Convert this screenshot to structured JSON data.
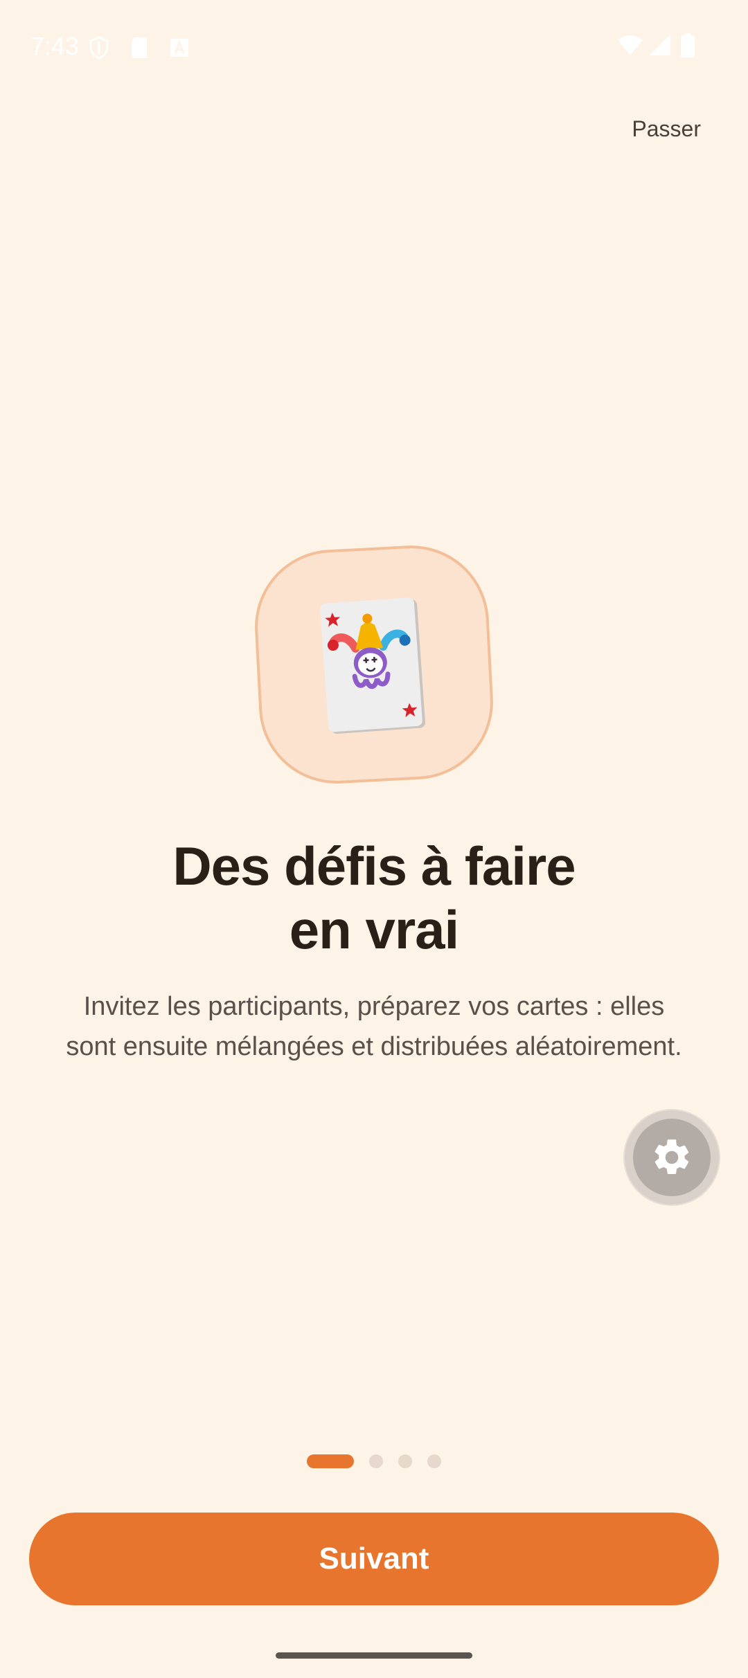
{
  "status_bar": {
    "time": "7:43",
    "icons_left": [
      "shield-icon",
      "sd-card-icon",
      "keyboard-a-icon"
    ],
    "icons_right": [
      "wifi-icon",
      "cell-signal-icon",
      "battery-icon"
    ]
  },
  "header": {
    "skip_label": "Passer"
  },
  "onboarding": {
    "illustration_icon": "joker-card-icon",
    "title_line1": "Des défis à faire",
    "title_line2": "en vrai",
    "description_line1": "Invitez les participants, préparez vos cartes : elles",
    "description_line2": "sont ensuite mélangées et distribuées aléatoirement."
  },
  "pager": {
    "total_pages": 4,
    "current_page": 1
  },
  "actions": {
    "next_label": "Suivant",
    "settings_icon": "gear-icon"
  },
  "colors": {
    "background": "#fdf3e7",
    "accent": "#e8752e",
    "illustration_bg": "#fbe3cf",
    "illustration_border": "#f2bf98"
  }
}
